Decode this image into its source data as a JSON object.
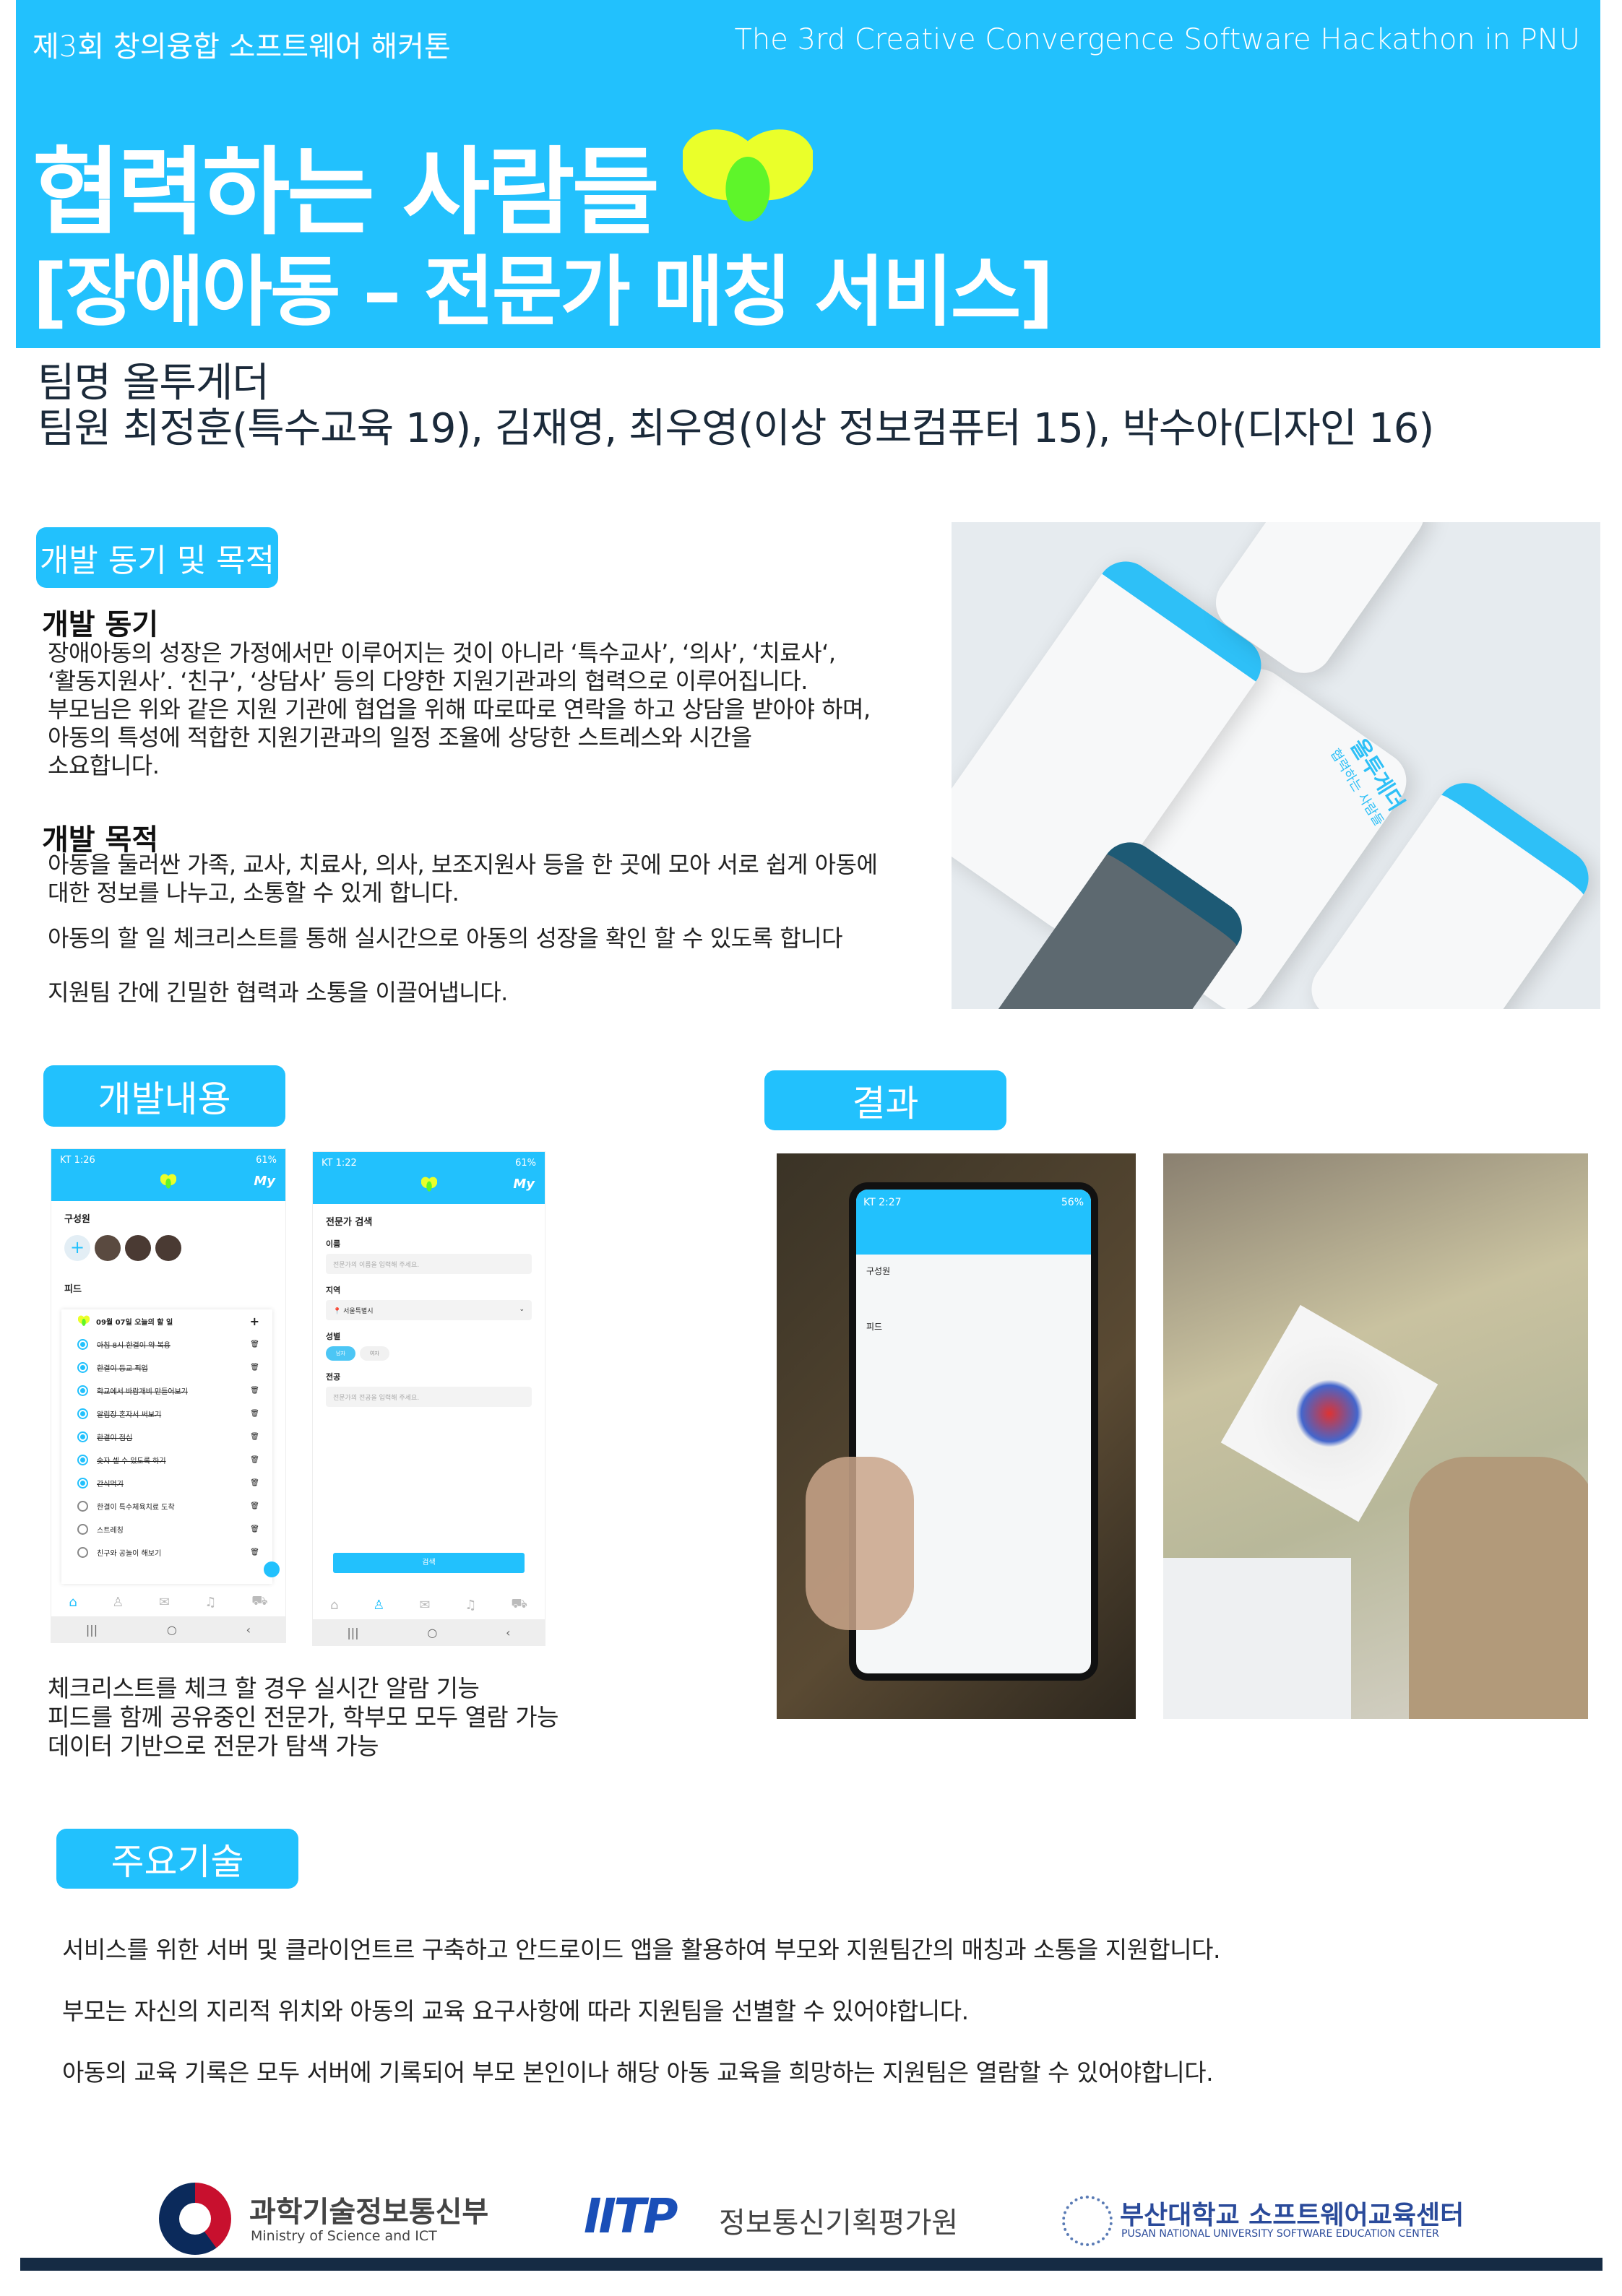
{
  "header": {
    "event_ko": "제3회 창의융합 소프트웨어 해커톤",
    "event_en": "The 3rd Creative Convergence Software Hackathon in PNU",
    "title": "협력하는 사람들",
    "subtitle": "[장애아동 – 전문가 매칭 서비스]",
    "brand_colors": {
      "primary": "#22c1fd",
      "heart_yellow": "#eaff2a",
      "heart_green": "#5ef52a",
      "footer": "#152b44"
    }
  },
  "team": {
    "name_line": "팀명 올투게더",
    "members_line": "팀원 최정훈(특수교육 19), 김재영, 최우영(이상 정보컴퓨터 15), 박수아(디자인 16)"
  },
  "motivation": {
    "label": "개발 동기 및 목적",
    "motive_heading": "개발 동기",
    "motive_lines": [
      "장애아동의 성장은 가정에서만 이루어지는 것이 아니라 ‘특수교사’, ‘의사’, ‘치료사‘,",
      "‘활동지원사’. ‘친구’, ‘상담사’ 등의 다양한 지원기관과의 협력으로 이루어집니다.",
      "부모님은 위와 같은 지원 기관에 협업을 위해 따로따로 연락을 하고 상담을 받아야 하며,",
      "아동의 특성에 적합한 지원기관과의 일정 조율에 상당한 스트레스와 시간을",
      "소요합니다."
    ],
    "purpose_heading": "개발 목적",
    "purpose_lines": [
      "아동을 둘러싼 가족,  교사, 치료사, 의사, 보조지원사 등을 한 곳에 모아 서로 쉽게 아동에",
      "대한 정보를 나누고, 소통할 수 있게 합니다."
    ],
    "purpose_2": "아동의 할 일 체크리스트를 통해 실시간으로 아동의 성장을 확인 할 수 있도록 합니다",
    "purpose_3": "지원팀 간에 긴밀한 협력과 소통을 이끌어냅니다.",
    "mockup_splash": {
      "title": "올투게더",
      "subtitle": "협력하는 사람들"
    }
  },
  "development": {
    "label": "개발내용",
    "feed_screen": {
      "status": "KT 1:26",
      "battery": "61%",
      "my": "My",
      "members_heading": "구성원",
      "feed_heading": "피드",
      "feed_date": "09월 07일 오늘의 할 일",
      "todos": [
        {
          "text": "아침 8시 한결이 약 복용",
          "done": true
        },
        {
          "text": "한결이 등교 픽업",
          "done": true
        },
        {
          "text": "학교에서 바람개비 만들어보기",
          "done": true
        },
        {
          "text": "알림장 혼자서 써보기",
          "done": true
        },
        {
          "text": "한결이 점심",
          "done": true
        },
        {
          "text": "숫자 셀 수 있도록 하기",
          "done": true
        },
        {
          "text": "간식먹기",
          "done": true
        },
        {
          "text": "한결이 특수체육치료 도착",
          "done": false
        },
        {
          "text": "스트레칭",
          "done": false
        },
        {
          "text": "친구와 공놀이 해보기",
          "done": false
        }
      ]
    },
    "search_screen": {
      "status": "KT 1:22",
      "battery": "61%",
      "my": "My",
      "heading": "전문가 검색",
      "name_label": "이름",
      "name_placeholder": "전문가의 이름을 입력해 주세요.",
      "region_label": "지역",
      "region_value": "서울특별시",
      "gender_label": "성별",
      "gender_options": [
        "남자",
        "여자"
      ],
      "gender_selected": "남자",
      "major_label": "전공",
      "major_placeholder": "전문가의 전공을 입력해 주세요.",
      "search_button": "검색"
    },
    "features": [
      "체크리스트를 체크 할 경우 실시간 알람 기능",
      "피드를 함께 공유중인 전문가, 학부모 모두 열람 가능",
      "데이터 기반으로 전문가 탐색 가능"
    ]
  },
  "result": {
    "label": "결과",
    "phone_status": "KT 2:27",
    "battery": "56%"
  },
  "tech": {
    "label": "주요기술",
    "lines": [
      "서비스를 위한 서버 및 클라이언트르 구축하고 안드로이드 앱을 활용하여 부모와 지원팀간의 매칭과 소통을 지원합니다.",
      "부모는 자신의 지리적 위치와 아동의 교육 요구사항에 따라 지원팀을 선별할 수 있어야합니다.",
      "아동의 교육 기록은 모두 서버에 기록되어 부모 본인이나 해당 아동 교육을 희망하는 지원팀은 열람할 수 있어야합니다."
    ]
  },
  "footer": {
    "msit_ko": "과학기술정보통신부",
    "msit_en": "Ministry of Science and ICT",
    "iitp_mark": "IITP",
    "iitp_ko": "정보통신기획평가원",
    "pnu_ko": "부산대학교 소프트웨어교육센터",
    "pnu_en": "PUSAN NATIONAL UNIVERSITY SOFTWARE EDUCATION CENTER"
  }
}
